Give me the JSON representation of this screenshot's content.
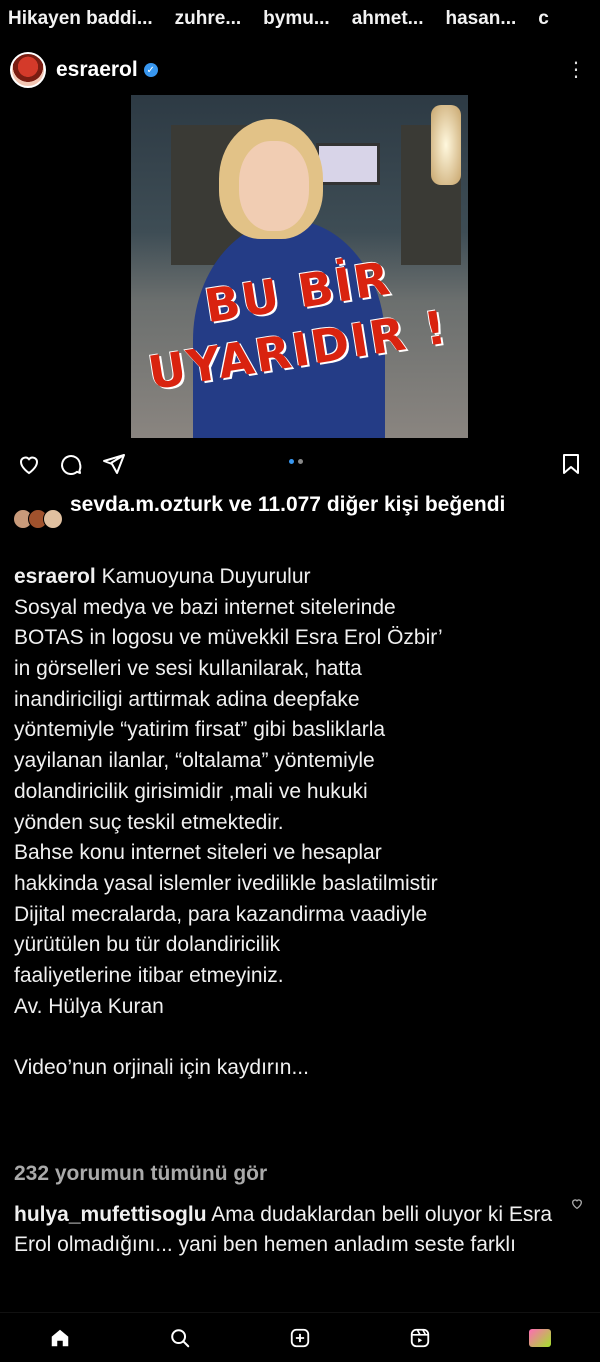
{
  "stories": [
    "Hikayen baddi...",
    "zuhre...",
    "bymu...",
    "ahmet...",
    "hasan...",
    "c"
  ],
  "post": {
    "username": "esraerol",
    "overlay_line1": "BU BİR",
    "overlay_line2": "UYARIDIR !"
  },
  "likes": {
    "text": "sevda.m.ozturk ve 11.077 diğer kişi beğendi"
  },
  "caption": {
    "username": "esraerol",
    "first_line": "Kamuoyuna Duyurulur",
    "lines": [
      "Sosyal medya ve bazi internet sitelerinde",
      "BOTAS in logosu ve müvekkil Esra Erol Özbir’",
      "in görselleri ve sesi kullanilarak, hatta",
      "inandiriciligi arttirmak adina deepfake",
      "yöntemiyle “yatirim firsat” gibi basliklarla",
      "yayilanan ilanlar, “oltalama” yöntemiyle",
      "dolandiricilik girisimidir ,mali ve hukuki",
      "yönden suç teskil etmektedir.",
      "Bahse konu internet siteleri ve hesaplar",
      "hakkinda yasal islemler ivedilikle baslatilmistir",
      "Dijital mecralarda, para kazandirma vaadiyle",
      "yürütülen bu tür dolandiricilik",
      "faaliyetlerine itibar etmeyiniz.",
      "Av. Hülya Kuran",
      "",
      "Video’nun orjinali için kaydırın..."
    ]
  },
  "comments_link": "232 yorumun tümünü gör",
  "comment": {
    "username": "hulya_mufettisoglu",
    "text": "Ama dudaklardan belli oluyor ki Esra Erol olmadığını... yani ben hemen anladım seste farklı"
  },
  "colors": {
    "background": "#000000",
    "accent": "#3897f0",
    "overlay_red": "#d9230f"
  },
  "icons": {
    "actions": [
      "heart-icon",
      "comment-icon",
      "share-icon",
      "bookmark-icon"
    ],
    "nav": [
      "home-icon",
      "search-icon",
      "create-icon",
      "reels-icon",
      "profile-avatar"
    ]
  }
}
